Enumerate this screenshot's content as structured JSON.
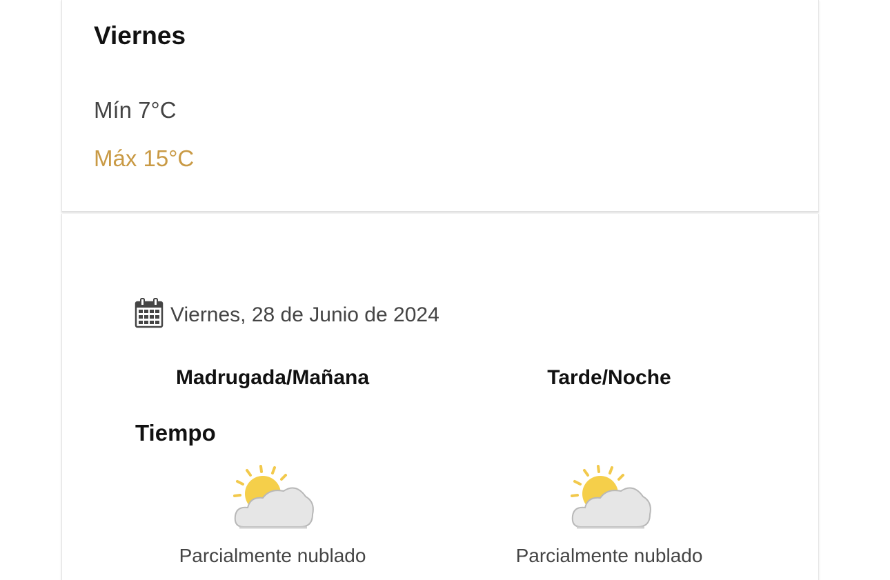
{
  "summary": {
    "day": "Viernes",
    "min_temp": "Mín 7°C",
    "max_temp": "Máx 15°C",
    "max_color": "#c99a45"
  },
  "detail": {
    "date": "Viernes, 28 de Junio de 2024",
    "date_icon": "calendar-icon",
    "periods": [
      {
        "label": "Madrugada/Mañana",
        "icon": "partly-cloudy-icon",
        "condition": "Parcialmente nublado"
      },
      {
        "label": "Tarde/Noche",
        "icon": "partly-cloudy-icon",
        "condition": "Parcialmente nublado"
      }
    ],
    "section_label": "Tiempo"
  }
}
